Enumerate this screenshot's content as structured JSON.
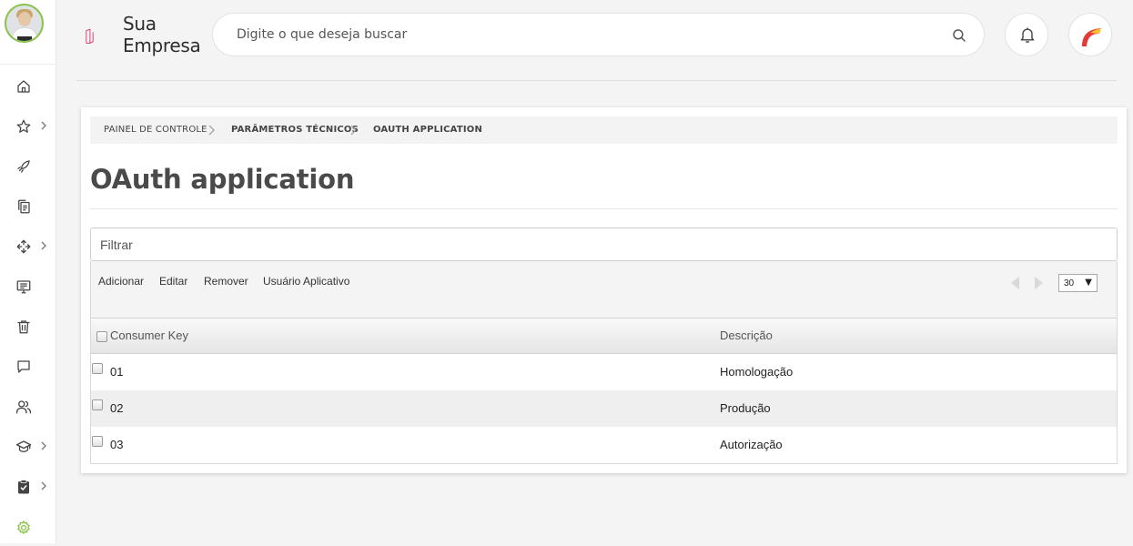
{
  "brand": {
    "name_line1": "Sua",
    "name_line2": "Empresa",
    "logo_color": "#d81b60"
  },
  "search": {
    "placeholder": "Digite o que deseja buscar"
  },
  "sidebar": {
    "items": [
      {
        "icon": "home-icon",
        "has_submenu": false
      },
      {
        "icon": "star-icon",
        "has_submenu": true
      },
      {
        "icon": "rocket-icon",
        "has_submenu": false
      },
      {
        "icon": "documents-icon",
        "has_submenu": false
      },
      {
        "icon": "integrations-icon",
        "has_submenu": true
      },
      {
        "icon": "monitor-icon",
        "has_submenu": false
      },
      {
        "icon": "trash-icon",
        "has_submenu": false
      },
      {
        "icon": "chat-icon",
        "has_submenu": false
      },
      {
        "icon": "users-icon",
        "has_submenu": false
      },
      {
        "icon": "graduation-cap-icon",
        "has_submenu": true
      },
      {
        "icon": "clipboard-check-icon",
        "has_submenu": true
      },
      {
        "icon": "gear-icon",
        "has_submenu": false
      }
    ],
    "active_color": "#8bc34a"
  },
  "breadcrumb": [
    "Painel de controle",
    "Parâmetros técnicos",
    "OAuth application"
  ],
  "page": {
    "title": "OAuth application"
  },
  "filter": {
    "placeholder": "Filtrar"
  },
  "toolbar": {
    "add": "Adicionar",
    "edit": "Editar",
    "remove": "Remover",
    "app_user": "Usuário Aplicativo"
  },
  "pager": {
    "page_size": "30"
  },
  "table": {
    "columns": [
      "Consumer Key",
      "Descrição"
    ],
    "rows": [
      {
        "key": "01",
        "description": "Homologação"
      },
      {
        "key": "02",
        "description": "Produção"
      },
      {
        "key": "03",
        "description": "Autorização"
      }
    ]
  }
}
